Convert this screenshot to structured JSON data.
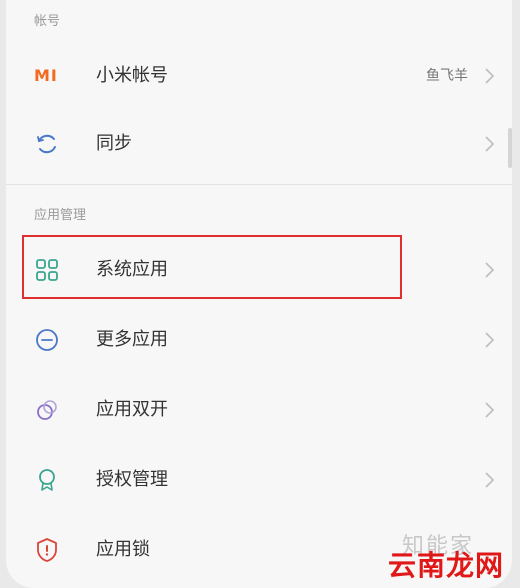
{
  "sections": {
    "account_header": "帐号",
    "apps_header": "应用管理"
  },
  "account": {
    "logo_text": "MI",
    "mi_account_label": "小米帐号",
    "mi_account_value": "鱼飞羊",
    "sync_label": "同步"
  },
  "apps": {
    "system_apps_label": "系统应用",
    "more_apps_label": "更多应用",
    "dual_apps_label": "应用双开",
    "permissions_label": "授权管理",
    "app_lock_label": "应用锁"
  },
  "icons": {
    "sync": "sync-icon",
    "system_apps": "grid-icon",
    "more_apps": "more-dots-icon",
    "dual_apps": "dual-circles-icon",
    "permissions": "badge-icon",
    "app_lock": "shield-icon",
    "chevron": "chevron-right-icon"
  },
  "colors": {
    "highlight_border": "#e02f2f",
    "mi_orange": "#f26a21",
    "icon_teal": "#3aa58f",
    "icon_blue": "#4a78c8",
    "icon_red": "#d9473b",
    "watermark_red": "#e01818"
  },
  "watermarks": {
    "site_gray": "知能家",
    "site_red": "云南龙网"
  }
}
